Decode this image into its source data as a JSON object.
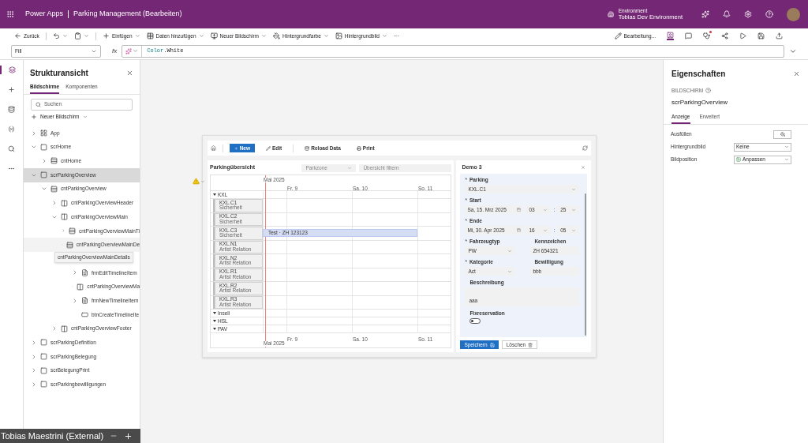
{
  "app_bar": {
    "app_name": "Power Apps",
    "title": "Parking Management (Bearbeiten)",
    "environment_label": "Environment",
    "environment": "Tobias Dev Environment"
  },
  "toolbar": {
    "left": [
      {
        "kind": "back",
        "label": "Zurück",
        "menu": false
      },
      {
        "kind": "undo",
        "menu": true
      },
      {
        "kind": "paste",
        "menu": true
      },
      {
        "kind": "insert",
        "label": "Einfügen",
        "menu": true
      },
      {
        "kind": "data",
        "label": "Daten hinzufügen",
        "menu": true
      },
      {
        "kind": "screen",
        "label": "Neuer Bildschirm",
        "menu": true
      },
      {
        "kind": "fill",
        "label": "Hintergrundfarbe",
        "menu": true
      },
      {
        "kind": "image",
        "label": "Hintergrundbild",
        "menu": true
      },
      {
        "kind": "more",
        "label": "···",
        "menu": false
      }
    ],
    "right": [
      {
        "kind": "edit",
        "label": "Bearbeitung...",
        "selected": false
      },
      {
        "kind": "app",
        "selected": true
      },
      {
        "kind": "comment",
        "selected": false
      },
      {
        "kind": "checker",
        "selected": false
      },
      {
        "kind": "share",
        "selected": false
      },
      {
        "kind": "play",
        "selected": false
      },
      {
        "kind": "save",
        "selected": false
      },
      {
        "kind": "publish",
        "selected": false
      }
    ]
  },
  "formula_bar": {
    "property": "Fill",
    "fx": "fx",
    "object": "Color",
    "member": ".White"
  },
  "rail": [
    {
      "kind": "tree",
      "selected": true
    },
    {
      "kind": "insert",
      "selected": false
    },
    {
      "kind": "data",
      "selected": false
    },
    {
      "kind": "variables",
      "selected": false
    },
    {
      "kind": "search",
      "selected": false
    },
    {
      "kind": "more",
      "selected": false
    }
  ],
  "tree": {
    "title": "Strukturansicht",
    "tabs": [
      {
        "label": "Bildschirme",
        "selected": true
      },
      {
        "label": "Komponenten",
        "selected": false
      }
    ],
    "search_placeholder": "Suchen",
    "new_screen": "Neuer Bildschirm",
    "nodes": [
      {
        "name": "App",
        "kind": "app",
        "expanded": false,
        "selected": false
      },
      {
        "name": "scrHome",
        "kind": "screen",
        "expanded": true,
        "selected": false,
        "children": [
          {
            "name": "cntHome",
            "kind": "container",
            "expanded": false,
            "selected": false
          }
        ]
      },
      {
        "name": "scrParkingOverview",
        "kind": "screen",
        "expanded": true,
        "selected": true,
        "children": [
          {
            "name": "cntParkingOverview",
            "kind": "container",
            "expanded": true,
            "selected": false,
            "children": [
              {
                "name": "cntParkingOverviewHeader",
                "kind": "hcontainer",
                "expanded": false,
                "selected": false
              },
              {
                "name": "cntParkingOverviewMain",
                "kind": "hcontainer",
                "expanded": true,
                "selected": false,
                "children": [
                  {
                    "name": "cntParkingOverviewMainTi",
                    "kind": "container",
                    "expanded": false,
                    "selected": false
                  },
                  {
                    "name": "cntParkingOverviewMainDe",
                    "kind": "container",
                    "expanded": true,
                    "selected": false,
                    "tooltip": "cntParkingOverviewMainDetails",
                    "children": [
                      {
                        "name": "frmEditTimelineItem",
                        "kind": "form",
                        "expanded": false,
                        "selected": false
                      },
                      {
                        "name": "cntParkingOverviewMa",
                        "kind": "hcontainer",
                        "expanded": false,
                        "selected": false
                      },
                      {
                        "name": "frmNewTimelineItem",
                        "kind": "form",
                        "expanded": false,
                        "selected": false
                      },
                      {
                        "name": "btnCreateTimelineIte",
                        "kind": "button",
                        "selected": false
                      }
                    ]
                  }
                ]
              },
              {
                "name": "cntParkingOverviewFooter",
                "kind": "hcontainer",
                "expanded": false,
                "selected": false
              }
            ]
          }
        ]
      },
      {
        "name": "scrParkingDefinition",
        "kind": "screen",
        "expanded": false,
        "selected": false
      },
      {
        "name": "scrParkingBelegung",
        "kind": "screen",
        "expanded": false,
        "selected": false
      },
      {
        "name": "scrBelegungPrint",
        "kind": "screen",
        "expanded": false,
        "selected": false
      },
      {
        "name": "scrParkingbewilligungen",
        "kind": "screen",
        "expanded": false,
        "selected": false
      }
    ]
  },
  "user_bar": {
    "name": "Tobias Maestrini (External)"
  },
  "preview": {
    "toolbar": [
      {
        "kind": "new",
        "label": "New"
      },
      {
        "kind": "edit",
        "label": "Edit"
      },
      {
        "kind": "reload",
        "label": "Reload Data"
      },
      {
        "kind": "print",
        "label": "Print"
      }
    ],
    "overview": {
      "title": "Parkingübersicht",
      "zone_placeholder": "Parkzone",
      "filter_placeholder": "Übersicht filtern",
      "month": "Mai 2025",
      "days": [
        "Fr. 9",
        "Sa. 10",
        "So. 11"
      ],
      "bottom_days": [
        "Fr. 9",
        "Sa. 10",
        "So. 11"
      ],
      "bottom_month": "Mai 2025",
      "groups": [
        {
          "name": "KXL",
          "expanded": true,
          "resources": [
            {
              "name": "KXL.C1",
              "sub": "Sicherheit"
            },
            {
              "name": "KXL.C2",
              "sub": "Sicherheit"
            },
            {
              "name": "KXL.C3",
              "sub": "Sicherheit",
              "event": "Test · ZH 123123"
            },
            {
              "name": "KXL.N1",
              "sub": "Artist Relation"
            },
            {
              "name": "KXL.N2",
              "sub": "Artist Relation"
            },
            {
              "name": "KXL.R1",
              "sub": "Artist Relation"
            },
            {
              "name": "KXL.R2",
              "sub": "Artist Relation"
            },
            {
              "name": "KXL.R3",
              "sub": "Artist Relation"
            }
          ]
        },
        {
          "name": "Inseli",
          "expanded": true
        },
        {
          "name": "HSL",
          "expanded": true
        },
        {
          "name": "PAV",
          "expanded": true
        }
      ]
    },
    "form": {
      "title": "Demo 3",
      "required_mark": "*",
      "time_separator": ":",
      "parking": {
        "label": "Parking",
        "required": true,
        "value": "KXL.C1"
      },
      "start": {
        "label": "Start",
        "required": true,
        "date": "Sa, 15. Mrz 2025",
        "hour": "03",
        "minute": "25"
      },
      "end": {
        "label": "Ende",
        "required": true,
        "date": "Mi, 30. Apr 2025",
        "hour": "16",
        "minute": "05"
      },
      "vehicle": {
        "label": "Fahrzeugtyp",
        "required": true,
        "value": "PW"
      },
      "plate": {
        "label": "Kennzeichen",
        "required": false,
        "value": "ZH 654321"
      },
      "category": {
        "label": "Kategorie",
        "required": true,
        "value": "Act"
      },
      "permit": {
        "label": "Bewilligung",
        "required": false,
        "value": "bbb"
      },
      "description": {
        "label": "Beschreibung",
        "value": "aaa"
      },
      "fixed": {
        "label": "Fixreservation",
        "on": false
      },
      "save": "Speichern",
      "delete": "Löschen"
    }
  },
  "properties": {
    "title": "Eigenschaften",
    "type": "BILDSCHIRM",
    "name": "scrParkingOverview",
    "tabs": [
      {
        "label": "Anzeige",
        "selected": true
      },
      {
        "label": "Erweitert",
        "selected": false
      }
    ],
    "rows": [
      {
        "kind": "color",
        "label": "Ausfüllen"
      },
      {
        "kind": "select",
        "label": "Hintergrundbild",
        "value": "Keine"
      },
      {
        "kind": "image_select",
        "label": "Bildposition",
        "value": "Anpassen"
      }
    ]
  }
}
